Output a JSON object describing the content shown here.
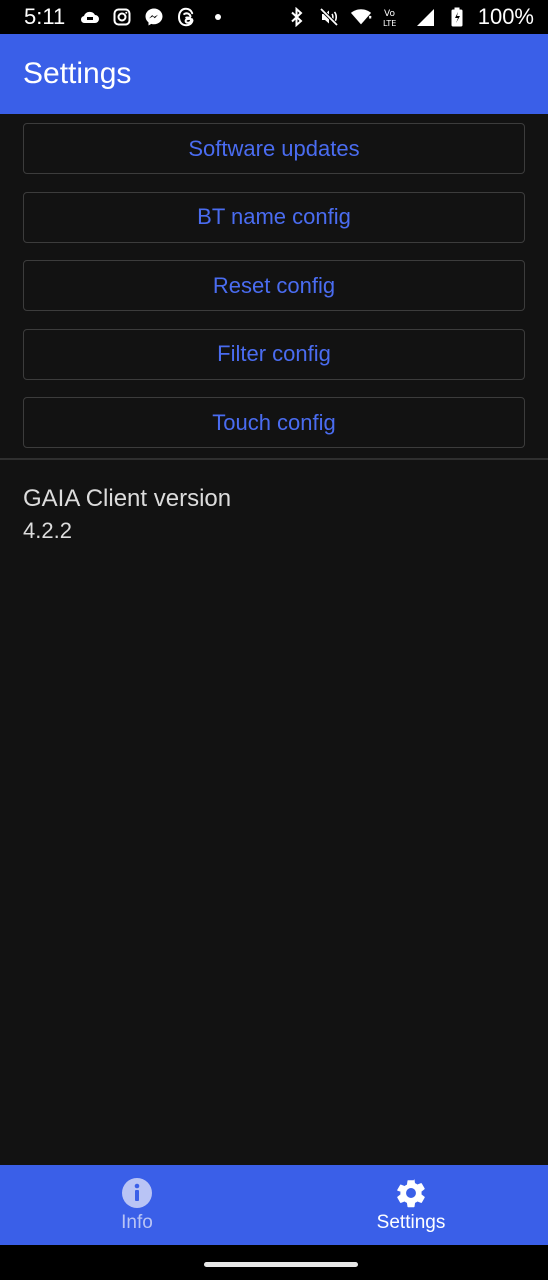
{
  "status_bar": {
    "time": "5:11",
    "battery": "100%",
    "left_icons": [
      "cloud-game-icon",
      "instagram-icon",
      "messenger-icon",
      "threads-icon",
      "dot-icon"
    ],
    "right_icons": [
      "bluetooth-icon",
      "mute-icon",
      "wifi-icon",
      "volte-icon",
      "signal-icon",
      "battery-icon"
    ]
  },
  "app_bar": {
    "title": "Settings"
  },
  "buttons": [
    {
      "label": "Software updates"
    },
    {
      "label": "BT name config"
    },
    {
      "label": "Reset config"
    },
    {
      "label": "Filter config"
    },
    {
      "label": "Touch config"
    }
  ],
  "version": {
    "label": "GAIA Client version",
    "value": "4.2.2"
  },
  "bottom_nav": {
    "items": [
      {
        "label": "Info",
        "icon": "info-icon",
        "active": false
      },
      {
        "label": "Settings",
        "icon": "gear-icon",
        "active": true
      }
    ]
  },
  "colors": {
    "accent": "#3a5fe8",
    "button_text": "#4a6cf0",
    "background": "#121212"
  }
}
